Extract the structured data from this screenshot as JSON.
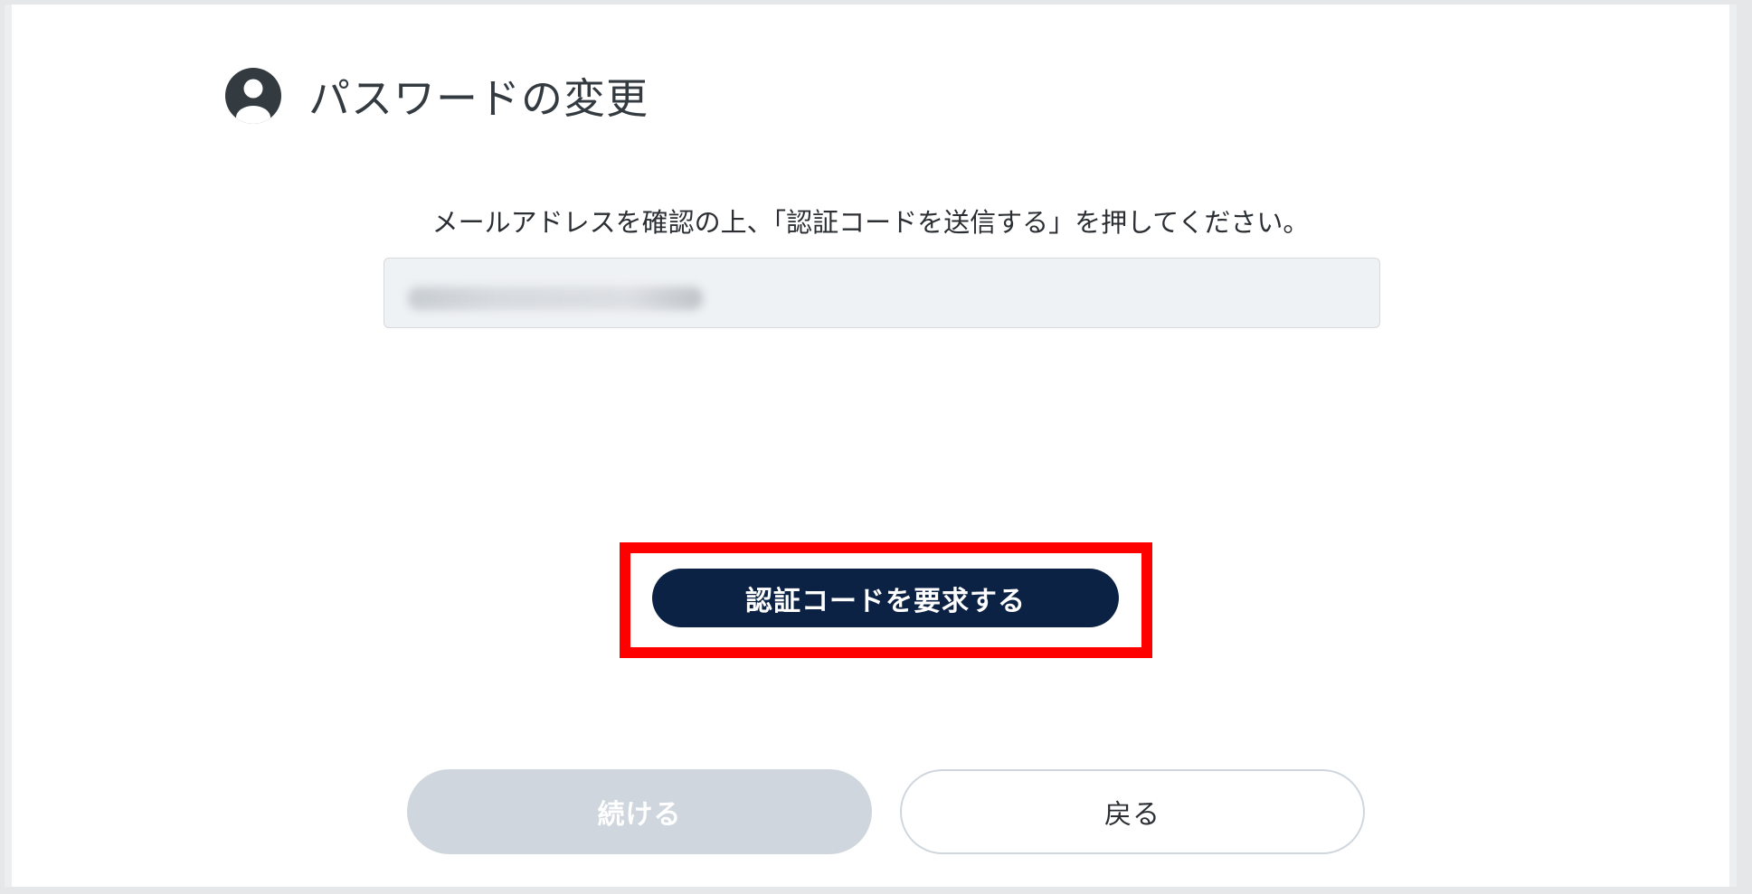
{
  "header": {
    "icon": "user-circle-icon",
    "title": "パスワードの変更"
  },
  "main": {
    "instruction": "メールアドレスを確認の上、「認証コードを送信する」を押してください。",
    "email_value": ""
  },
  "actions": {
    "request_code_label": "認証コードを要求する",
    "continue_label": "続ける",
    "back_label": "戻る"
  },
  "colors": {
    "primary": "#0c2244",
    "disabled": "#cfd6dd",
    "highlight": "#ff0000",
    "icon": "#333a40"
  }
}
